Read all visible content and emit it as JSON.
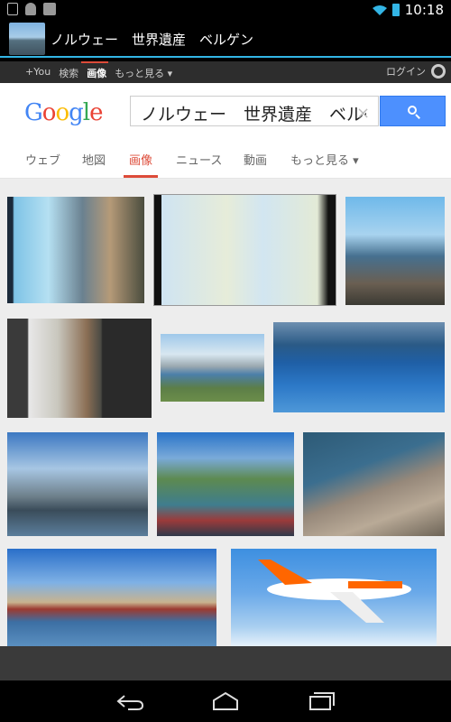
{
  "status": {
    "time": "10:18",
    "left_icons": [
      "sim-icon",
      "android-icon",
      "camera-icon"
    ]
  },
  "titlebar": {
    "title": "ノルウェー　世界遺産　ベルゲン"
  },
  "gbar": {
    "items": [
      "+You",
      "検索",
      "画像",
      "もっと見る ▾"
    ],
    "active_index": 2,
    "login": "ログイン"
  },
  "search": {
    "logo_letters": [
      {
        "ch": "G",
        "color": "#4285f4"
      },
      {
        "ch": "o",
        "color": "#ea4335"
      },
      {
        "ch": "o",
        "color": "#fbbc05"
      },
      {
        "ch": "g",
        "color": "#4285f4"
      },
      {
        "ch": "l",
        "color": "#34a853"
      },
      {
        "ch": "e",
        "color": "#ea4335"
      }
    ],
    "query": "ノルウェー　世界遺産　ベルゲン",
    "clear_symbol": "×"
  },
  "tabs": [
    "ウェブ",
    "地図",
    "画像",
    "ニュース",
    "動画",
    "もっと見る ▾"
  ],
  "active_tab": 2,
  "images": [
    {
      "name": "bergen-aerial-view-image"
    },
    {
      "name": "norway-map-image"
    },
    {
      "name": "bergen-city-harbor-image"
    },
    {
      "name": "bryggen-rotated-image"
    },
    {
      "name": "fjord-snow-mountains-image"
    },
    {
      "name": "blue-fjord-image"
    },
    {
      "name": "fjord-clouds-image"
    },
    {
      "name": "fjord-ship-deck-image"
    },
    {
      "name": "preikestolen-cliff-image"
    },
    {
      "name": "bryggen-waterfront-image"
    },
    {
      "name": "easyjet-airplane-image"
    }
  ],
  "colors": {
    "accent": "#33b5e5",
    "tab_active": "#dd4b39",
    "search_button": "#4d90fe"
  }
}
